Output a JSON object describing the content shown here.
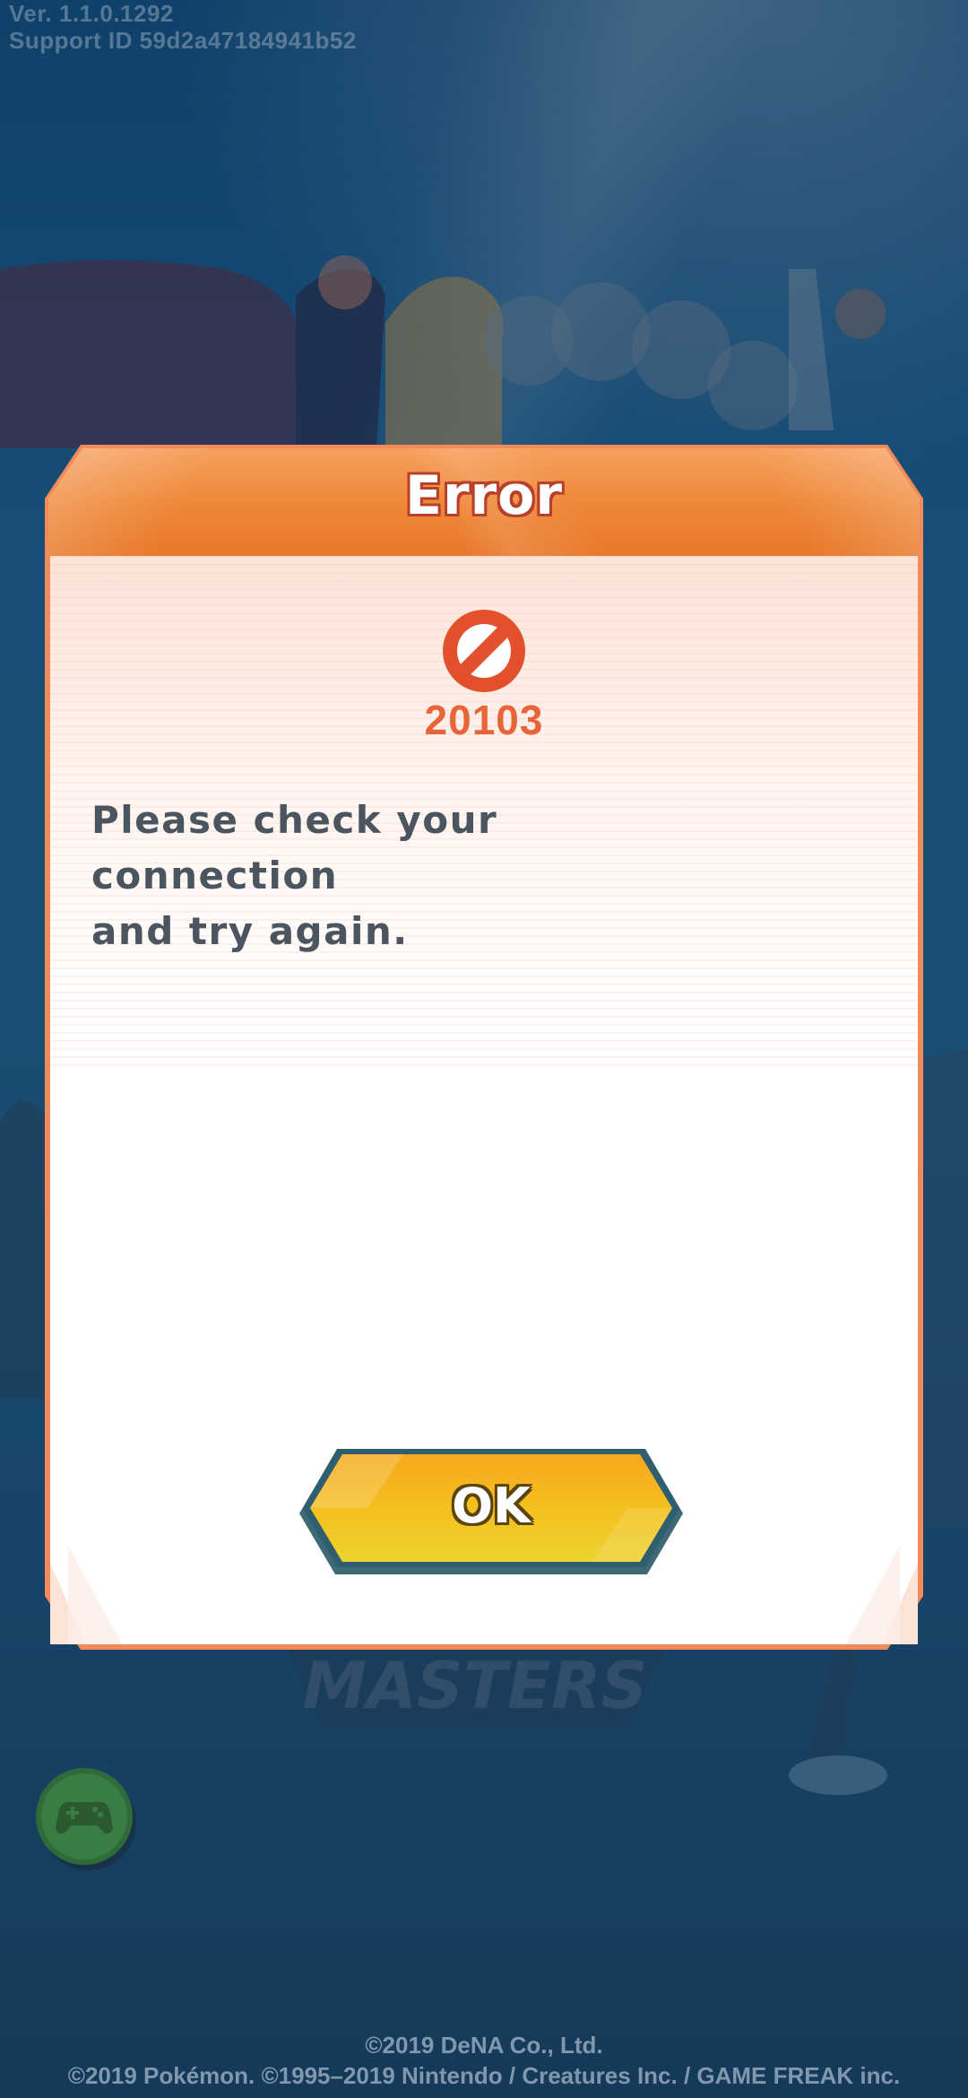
{
  "status": {
    "version": "Ver. 1.1.0.1292",
    "support_id": "Support ID 59d2a47184941b52"
  },
  "dialog": {
    "title": "Error",
    "icon": "prohibited-icon",
    "error_code": "20103",
    "message_line1": "Please check your connection",
    "message_line2": "and try again.",
    "ok_label": "OK"
  },
  "footer": {
    "line1": "©2019 DeNA Co., Ltd.",
    "line2": "©2019 Pokémon. ©1995–2019 Nintendo / Creatures Inc. / GAME FREAK inc."
  },
  "colors": {
    "header": "#ee8636",
    "error_red": "#e8643a",
    "button_yellow": "#f4c21f",
    "background_blue": "#1a5c8a"
  },
  "icons": {
    "game_controller": "gamepad-icon"
  }
}
